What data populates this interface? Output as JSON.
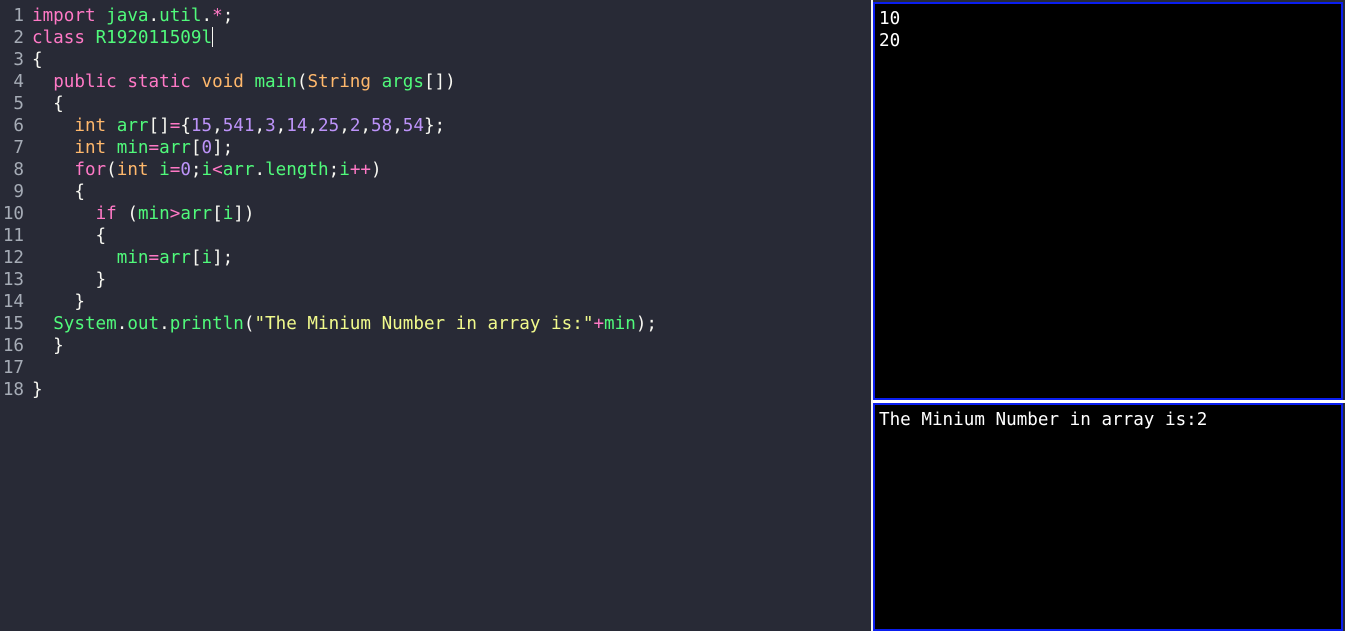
{
  "editor": {
    "lines": [
      {
        "n": "1",
        "tokens": [
          [
            "t-kw",
            "import"
          ],
          [
            "t-plain",
            " "
          ],
          [
            "t-cls",
            "java"
          ],
          [
            "t-plain",
            "."
          ],
          [
            "t-cls",
            "util"
          ],
          [
            "t-plain",
            "."
          ],
          [
            "t-op",
            "*"
          ],
          [
            "t-plain",
            ";"
          ]
        ]
      },
      {
        "n": "2",
        "tokens": [
          [
            "t-kw",
            "class"
          ],
          [
            "t-plain",
            " "
          ],
          [
            "t-cls",
            "R192011509l"
          ]
        ],
        "cursor": true
      },
      {
        "n": "3",
        "tokens": [
          [
            "t-plain",
            "{"
          ]
        ]
      },
      {
        "n": "4",
        "tokens": [
          [
            "t-plain",
            "  "
          ],
          [
            "t-kw",
            "public"
          ],
          [
            "t-plain",
            " "
          ],
          [
            "t-kw",
            "static"
          ],
          [
            "t-plain",
            " "
          ],
          [
            "t-type",
            "void"
          ],
          [
            "t-plain",
            " "
          ],
          [
            "t-cls",
            "main"
          ],
          [
            "t-plain",
            "("
          ],
          [
            "t-type",
            "String"
          ],
          [
            "t-plain",
            " "
          ],
          [
            "t-cls",
            "args"
          ],
          [
            "t-plain",
            "[])"
          ]
        ]
      },
      {
        "n": "5",
        "tokens": [
          [
            "t-plain",
            "  {"
          ]
        ]
      },
      {
        "n": "6",
        "tokens": [
          [
            "t-plain",
            "    "
          ],
          [
            "t-type",
            "int"
          ],
          [
            "t-plain",
            " "
          ],
          [
            "t-cls",
            "arr"
          ],
          [
            "t-plain",
            "[]"
          ],
          [
            "t-op",
            "="
          ],
          [
            "t-plain",
            "{"
          ],
          [
            "t-num",
            "15"
          ],
          [
            "t-plain",
            ","
          ],
          [
            "t-num",
            "541"
          ],
          [
            "t-plain",
            ","
          ],
          [
            "t-num",
            "3"
          ],
          [
            "t-plain",
            ","
          ],
          [
            "t-num",
            "14"
          ],
          [
            "t-plain",
            ","
          ],
          [
            "t-num",
            "25"
          ],
          [
            "t-plain",
            ","
          ],
          [
            "t-num",
            "2"
          ],
          [
            "t-plain",
            ","
          ],
          [
            "t-num",
            "58"
          ],
          [
            "t-plain",
            ","
          ],
          [
            "t-num",
            "54"
          ],
          [
            "t-plain",
            "};"
          ]
        ]
      },
      {
        "n": "7",
        "tokens": [
          [
            "t-plain",
            "    "
          ],
          [
            "t-type",
            "int"
          ],
          [
            "t-plain",
            " "
          ],
          [
            "t-cls",
            "min"
          ],
          [
            "t-op",
            "="
          ],
          [
            "t-cls",
            "arr"
          ],
          [
            "t-plain",
            "["
          ],
          [
            "t-num",
            "0"
          ],
          [
            "t-plain",
            "];"
          ]
        ]
      },
      {
        "n": "8",
        "tokens": [
          [
            "t-plain",
            "    "
          ],
          [
            "t-kw",
            "for"
          ],
          [
            "t-plain",
            "("
          ],
          [
            "t-type",
            "int"
          ],
          [
            "t-plain",
            " "
          ],
          [
            "t-cls",
            "i"
          ],
          [
            "t-op",
            "="
          ],
          [
            "t-num",
            "0"
          ],
          [
            "t-plain",
            ";"
          ],
          [
            "t-cls",
            "i"
          ],
          [
            "t-op",
            "<"
          ],
          [
            "t-cls",
            "arr"
          ],
          [
            "t-plain",
            "."
          ],
          [
            "t-cls",
            "length"
          ],
          [
            "t-plain",
            ";"
          ],
          [
            "t-cls",
            "i"
          ],
          [
            "t-op",
            "++"
          ],
          [
            "t-plain",
            ")"
          ]
        ]
      },
      {
        "n": "9",
        "tokens": [
          [
            "t-plain",
            "    {"
          ]
        ]
      },
      {
        "n": "10",
        "tokens": [
          [
            "t-plain",
            "      "
          ],
          [
            "t-kw",
            "if"
          ],
          [
            "t-plain",
            " ("
          ],
          [
            "t-cls",
            "min"
          ],
          [
            "t-op",
            ">"
          ],
          [
            "t-cls",
            "arr"
          ],
          [
            "t-plain",
            "["
          ],
          [
            "t-cls",
            "i"
          ],
          [
            "t-plain",
            "])"
          ]
        ]
      },
      {
        "n": "11",
        "tokens": [
          [
            "t-plain",
            "      {"
          ]
        ]
      },
      {
        "n": "12",
        "tokens": [
          [
            "t-plain",
            "        "
          ],
          [
            "t-cls",
            "min"
          ],
          [
            "t-op",
            "="
          ],
          [
            "t-cls",
            "arr"
          ],
          [
            "t-plain",
            "["
          ],
          [
            "t-cls",
            "i"
          ],
          [
            "t-plain",
            "];"
          ]
        ]
      },
      {
        "n": "13",
        "tokens": [
          [
            "t-plain",
            "      }"
          ]
        ]
      },
      {
        "n": "14",
        "tokens": [
          [
            "t-plain",
            "    }"
          ]
        ]
      },
      {
        "n": "15",
        "tokens": [
          [
            "t-plain",
            "  "
          ],
          [
            "t-cls",
            "System"
          ],
          [
            "t-plain",
            "."
          ],
          [
            "t-cls",
            "out"
          ],
          [
            "t-plain",
            "."
          ],
          [
            "t-cls",
            "println"
          ],
          [
            "t-plain",
            "("
          ],
          [
            "t-str",
            "\"The Minium Number in array is:\""
          ],
          [
            "t-op",
            "+"
          ],
          [
            "t-cls",
            "min"
          ],
          [
            "t-plain",
            ");"
          ]
        ]
      },
      {
        "n": "16",
        "tokens": [
          [
            "t-plain",
            "  }"
          ]
        ]
      },
      {
        "n": "17",
        "tokens": []
      },
      {
        "n": "18",
        "tokens": [
          [
            "t-plain",
            "}"
          ]
        ]
      }
    ]
  },
  "input_pane": {
    "text": "10\n20"
  },
  "output_pane": {
    "text": "The Minium Number in array is:2"
  },
  "colors": {
    "editor_bg": "#282a36",
    "pane_border": "#0a1ef0",
    "keyword": "#ff79c6",
    "type": "#ffb86c",
    "identifier": "#50fa7b",
    "number": "#bd93f9",
    "string": "#f1fa8c"
  }
}
